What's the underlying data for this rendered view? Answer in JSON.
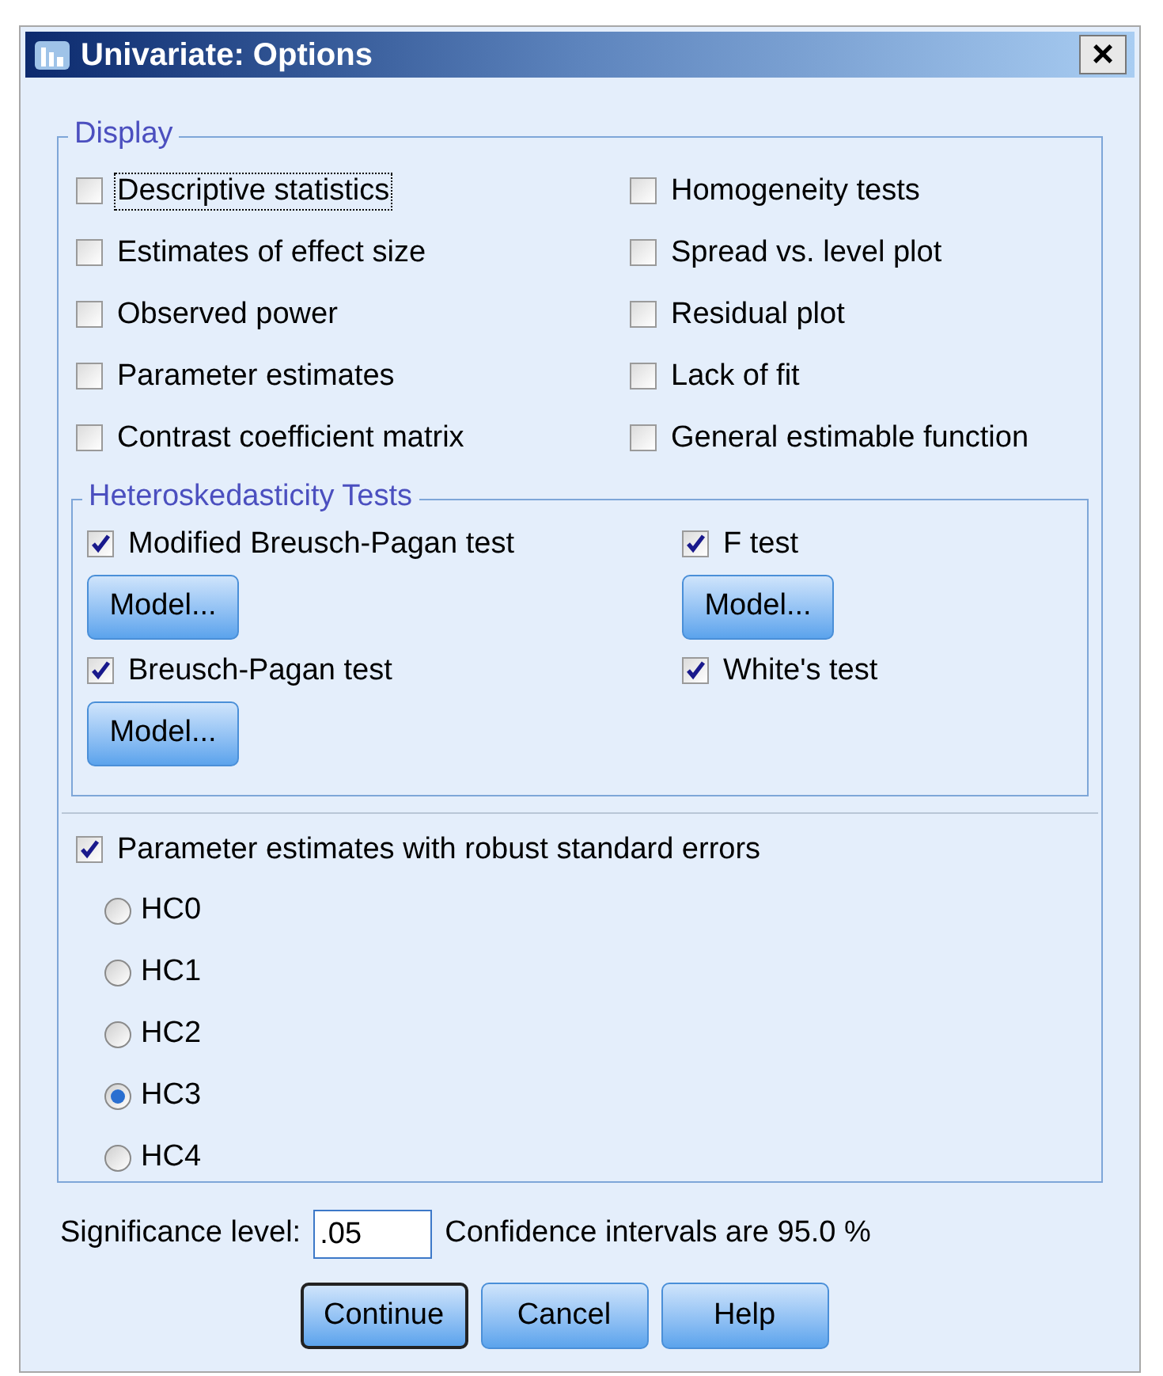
{
  "window": {
    "title": "Univariate: Options",
    "close": "×"
  },
  "display": {
    "title": "Display",
    "left": [
      {
        "label": "Descriptive statistics",
        "checked": false,
        "focused": true
      },
      {
        "label": "Estimates of effect size",
        "checked": false,
        "focused": false
      },
      {
        "label": "Observed power",
        "checked": false,
        "focused": false
      },
      {
        "label": "Parameter estimates",
        "checked": false,
        "focused": false
      },
      {
        "label": "Contrast coefficient matrix",
        "checked": false,
        "focused": false
      }
    ],
    "right": [
      {
        "label": "Homogeneity tests",
        "checked": false,
        "focused": false
      },
      {
        "label": "Spread vs. level plot",
        "checked": false,
        "focused": false
      },
      {
        "label": "Residual plot",
        "checked": false,
        "focused": false
      },
      {
        "label": "Lack of fit",
        "checked": false,
        "focused": false
      },
      {
        "label": "General estimable function",
        "checked": false,
        "focused": false
      }
    ]
  },
  "heteroskedasticity": {
    "title": "Heteroskedasticity Tests",
    "tests": [
      {
        "label": "Modified Breusch-Pagan test",
        "checked": true,
        "model_button": "Model..."
      },
      {
        "label": "F test",
        "checked": true,
        "model_button": "Model..."
      },
      {
        "label": "Breusch-Pagan test",
        "checked": true,
        "model_button": "Model..."
      },
      {
        "label": "White's test",
        "checked": true
      }
    ]
  },
  "robust": {
    "label": "Parameter estimates with robust standard errors",
    "checked": true
  },
  "hc_options": [
    {
      "label": "HC0",
      "selected": false
    },
    {
      "label": "HC1",
      "selected": false
    },
    {
      "label": "HC2",
      "selected": false
    },
    {
      "label": "HC3",
      "selected": true
    },
    {
      "label": "HC4",
      "selected": false
    }
  ],
  "significance": {
    "label": "Significance level:",
    "value": ".05",
    "note": "Confidence intervals are 95.0 %"
  },
  "buttons": [
    {
      "label": "Continue",
      "focused": true
    },
    {
      "label": "Cancel",
      "focused": false
    },
    {
      "label": "Help",
      "focused": false
    }
  ]
}
